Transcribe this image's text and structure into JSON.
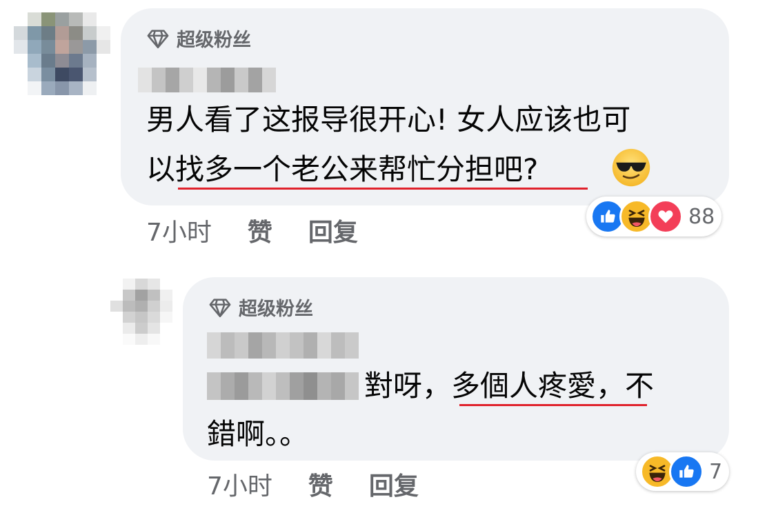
{
  "comment_1": {
    "badge": "超级粉丝",
    "text_part1": "男人看了这报导很开心! 女人应该也可",
    "text_part2_prefix": "以",
    "text_part2_underlined": "找多一个老公来帮忙分担吧",
    "text_part2_suffix": "?",
    "emoji": "smiling-face-with-sunglasses",
    "time": "7小时",
    "like_label": "赞",
    "reply_label": "回复",
    "reactions": [
      "like",
      "haha",
      "love"
    ],
    "reaction_count": "88"
  },
  "comment_2": {
    "badge": "超级粉丝",
    "text_part1_prefix": "對呀，",
    "text_part1_underlined": "多個人疼愛，",
    "text_part1_suffix": "不",
    "text_part2": "錯啊。。",
    "time": "7小时",
    "like_label": "赞",
    "reply_label": "回复",
    "reactions": [
      "haha",
      "like"
    ],
    "reaction_count": "7"
  },
  "colors": {
    "bubble": "#f0f2f5",
    "underline": "#e0212b",
    "meta_text": "#65676b",
    "like_blue": "#1877f2",
    "love_red": "#f33e58",
    "haha_yellow": "#f7b928"
  }
}
